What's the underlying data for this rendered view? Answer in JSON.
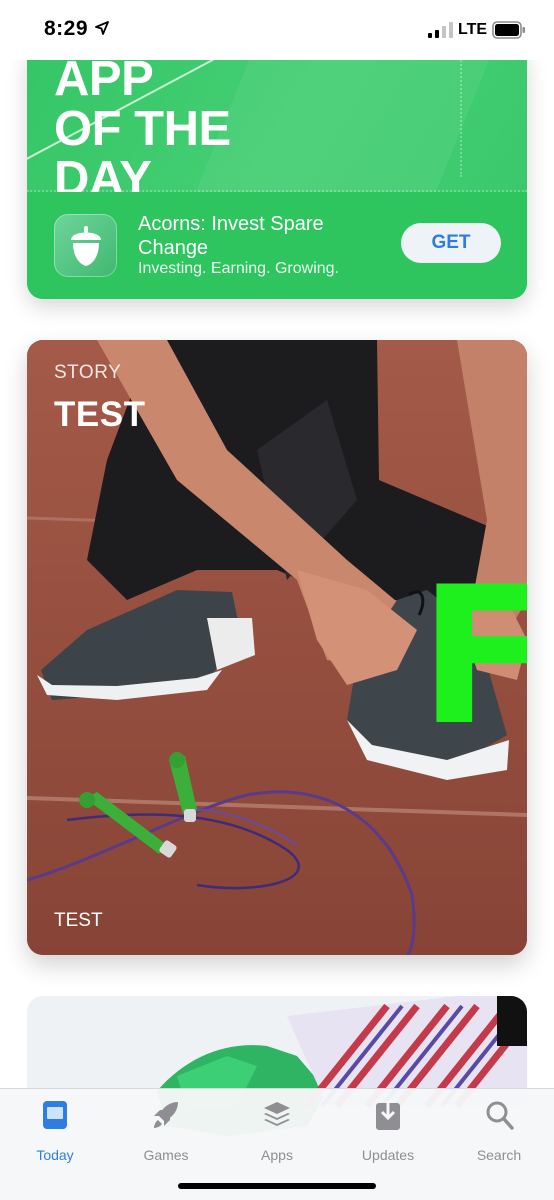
{
  "status_bar": {
    "time": "8:29",
    "network": "LTE",
    "icons": [
      "location-arrow-icon",
      "signal-bars-icon",
      "battery-icon"
    ]
  },
  "app_of_the_day": {
    "title_lines": [
      "APP",
      "OF THE",
      "DAY"
    ],
    "app_name": "Acorns: Invest Spare Change",
    "subtitle": "Investing. Earning. Growing.",
    "get_label": "GET",
    "icon": "acorn-icon",
    "accent": "#2ec55f"
  },
  "story_card": {
    "label": "STORY",
    "title": "TEST",
    "footer": "TEST",
    "overlay_letter": "F",
    "overlay_color": "#1ef01e"
  },
  "tab_bar": {
    "active_color": "#2f7de1",
    "inactive_color": "#8e8e93",
    "tabs": [
      {
        "label": "Today",
        "icon": "today-icon",
        "active": true
      },
      {
        "label": "Games",
        "icon": "rocket-icon",
        "active": false
      },
      {
        "label": "Apps",
        "icon": "layers-icon",
        "active": false
      },
      {
        "label": "Updates",
        "icon": "download-icon",
        "active": false
      },
      {
        "label": "Search",
        "icon": "search-icon",
        "active": false
      }
    ]
  }
}
